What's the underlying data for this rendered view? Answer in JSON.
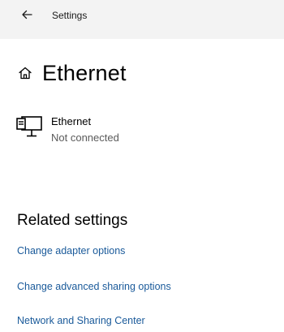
{
  "window": {
    "title": "Settings",
    "back_icon": "arrow-left-icon"
  },
  "page": {
    "title": "Ethernet",
    "title_icon": "home-icon"
  },
  "network": {
    "icon": "desktop-pc-icon",
    "name": "Ethernet",
    "status": "Not connected"
  },
  "related_settings": {
    "heading": "Related settings",
    "links": [
      {
        "label": "Change adapter options"
      },
      {
        "label": "Change advanced sharing options"
      },
      {
        "label": "Network and Sharing Center"
      }
    ]
  },
  "colors": {
    "titlebar_bg": "#f3f3f3",
    "link": "#1a5a9a",
    "secondary_text": "#5a5a5a"
  }
}
